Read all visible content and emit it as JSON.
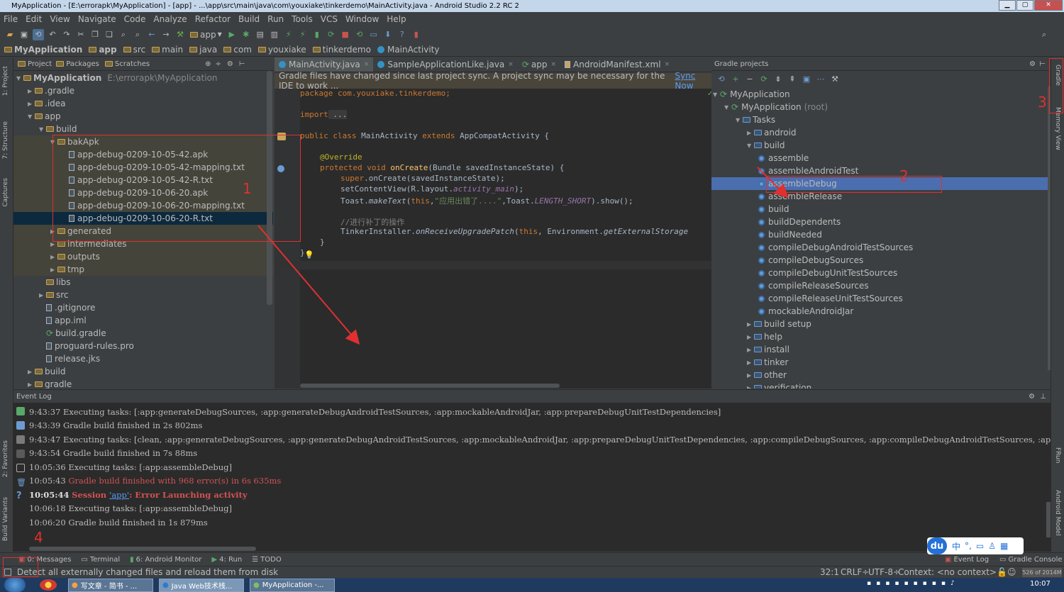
{
  "window": {
    "title": "MyApplication - [E:\\errorapk\\MyApplication] - [app] - ...\\app\\src\\main\\java\\com\\youxiake\\tinkerdemo\\MainActivity.java - Android Studio 2.2 RC 2"
  },
  "menu": [
    "File",
    "Edit",
    "View",
    "Navigate",
    "Code",
    "Analyze",
    "Refactor",
    "Build",
    "Run",
    "Tools",
    "VCS",
    "Window",
    "Help"
  ],
  "toolbar": {
    "run_config": "app"
  },
  "breadcrumb": [
    "MyApplication",
    "app",
    "src",
    "main",
    "java",
    "com",
    "youxiake",
    "tinkerdemo",
    "MainActivity"
  ],
  "project_panel": {
    "tabs": [
      "Project",
      "Packages",
      "Scratches"
    ],
    "tree": [
      {
        "label": "MyApplication",
        "extra": "E:\\errorapk\\MyApplication",
        "level": 0,
        "type": "module",
        "open": true
      },
      {
        "label": ".gradle",
        "level": 1,
        "type": "folder",
        "open": false
      },
      {
        "label": ".idea",
        "level": 1,
        "type": "folder",
        "open": false
      },
      {
        "label": "app",
        "level": 1,
        "type": "folder",
        "open": true
      },
      {
        "label": "build",
        "level": 2,
        "type": "folder",
        "open": true
      },
      {
        "label": "bakApk",
        "level": 3,
        "type": "folder",
        "open": true
      },
      {
        "label": "app-debug-0209-10-05-42.apk",
        "level": 4,
        "type": "file"
      },
      {
        "label": "app-debug-0209-10-05-42-mapping.txt",
        "level": 4,
        "type": "file"
      },
      {
        "label": "app-debug-0209-10-05-42-R.txt",
        "level": 4,
        "type": "file"
      },
      {
        "label": "app-debug-0209-10-06-20.apk",
        "level": 4,
        "type": "file"
      },
      {
        "label": "app-debug-0209-10-06-20-mapping.txt",
        "level": 4,
        "type": "file"
      },
      {
        "label": "app-debug-0209-10-06-20-R.txt",
        "level": 4,
        "type": "file",
        "selected": true
      },
      {
        "label": "generated",
        "level": 3,
        "type": "folder",
        "open": false
      },
      {
        "label": "intermediates",
        "level": 3,
        "type": "folder",
        "open": false
      },
      {
        "label": "outputs",
        "level": 3,
        "type": "folder",
        "open": false
      },
      {
        "label": "tmp",
        "level": 3,
        "type": "folder",
        "open": false
      },
      {
        "label": "libs",
        "level": 2,
        "type": "folder"
      },
      {
        "label": "src",
        "level": 2,
        "type": "folder",
        "open": false
      },
      {
        "label": ".gitignore",
        "level": 2,
        "type": "file"
      },
      {
        "label": "app.iml",
        "level": 2,
        "type": "file"
      },
      {
        "label": "build.gradle",
        "level": 2,
        "type": "gradle"
      },
      {
        "label": "proguard-rules.pro",
        "level": 2,
        "type": "file"
      },
      {
        "label": "release.jks",
        "level": 2,
        "type": "file"
      },
      {
        "label": "build",
        "level": 1,
        "type": "folder",
        "open": false
      },
      {
        "label": "gradle",
        "level": 1,
        "type": "folder",
        "open": false
      }
    ]
  },
  "editor": {
    "tabs": [
      {
        "label": "MainActivity.java",
        "active": true
      },
      {
        "label": "SampleApplicationLike.java",
        "active": false
      },
      {
        "label": "app",
        "active": false
      },
      {
        "label": "AndroidManifest.xml",
        "active": false
      }
    ],
    "notice": "Gradle files have changed since last project sync. A project sync may be necessary for the IDE to work ...",
    "notice_link": "Sync Now",
    "code": {
      "l1": "package com.youxiake.tinkerdemo;",
      "l2_kw": "import",
      "l2_rest": " ...",
      "l3_a": "public class ",
      "l3_b": "MainActivity ",
      "l3_c": "extends ",
      "l3_d": "AppCompatActivity {",
      "l4": "@Override",
      "l5_a": "protected void ",
      "l5_b": "onCreate",
      "l5_c": "(Bundle savedInstanceState) {",
      "l6_a": "super",
      "l6_b": ".onCreate(savedInstanceState);",
      "l7_a": "setContentView(R.layout.",
      "l7_b": "activity_main",
      "l7_c": ");",
      "l8_a": "Toast.",
      "l8_b": "makeText",
      "l8_c": "(",
      "l8_d": "this",
      "l8_e": ",",
      "l8_f": "\"应用出错了....\"",
      "l8_g": ",Toast.",
      "l8_h": "LENGTH_SHORT",
      "l8_i": ").show();",
      "l9": "//进行补丁的操作",
      "l10_a": "TinkerInstaller.",
      "l10_b": "onReceiveUpgradePatch",
      "l10_c": "(",
      "l10_d": "this",
      "l10_e": ", Environment.",
      "l10_f": "getExternalStorage",
      "l11": "}",
      "l12": "}"
    }
  },
  "gradle_panel": {
    "title": "Gradle projects",
    "tree": [
      {
        "label": "MyApplication",
        "level": 0,
        "type": "root"
      },
      {
        "label": "MyApplication",
        "extra": "(root)",
        "level": 1,
        "type": "root"
      },
      {
        "label": "Tasks",
        "level": 2,
        "type": "folder"
      },
      {
        "label": "android",
        "level": 3,
        "type": "folder",
        "collapsed": true
      },
      {
        "label": "build",
        "level": 3,
        "type": "folder"
      },
      {
        "label": "assemble",
        "level": 4,
        "type": "task"
      },
      {
        "label": "assembleAndroidTest",
        "level": 4,
        "type": "task"
      },
      {
        "label": "assembleDebug",
        "level": 4,
        "type": "task",
        "selected": true
      },
      {
        "label": "assembleRelease",
        "level": 4,
        "type": "task"
      },
      {
        "label": "build",
        "level": 4,
        "type": "task"
      },
      {
        "label": "buildDependents",
        "level": 4,
        "type": "task"
      },
      {
        "label": "buildNeeded",
        "level": 4,
        "type": "task"
      },
      {
        "label": "compileDebugAndroidTestSources",
        "level": 4,
        "type": "task"
      },
      {
        "label": "compileDebugSources",
        "level": 4,
        "type": "task"
      },
      {
        "label": "compileDebugUnitTestSources",
        "level": 4,
        "type": "task"
      },
      {
        "label": "compileReleaseSources",
        "level": 4,
        "type": "task"
      },
      {
        "label": "compileReleaseUnitTestSources",
        "level": 4,
        "type": "task"
      },
      {
        "label": "mockableAndroidJar",
        "level": 4,
        "type": "task"
      },
      {
        "label": "build setup",
        "level": 3,
        "type": "folder",
        "collapsed": true
      },
      {
        "label": "help",
        "level": 3,
        "type": "folder",
        "collapsed": true
      },
      {
        "label": "install",
        "level": 3,
        "type": "folder",
        "collapsed": true
      },
      {
        "label": "tinker",
        "level": 3,
        "type": "folder",
        "collapsed": true
      },
      {
        "label": "other",
        "level": 3,
        "type": "folder",
        "collapsed": true
      },
      {
        "label": "verification",
        "level": 3,
        "type": "folder",
        "collapsed": true
      }
    ]
  },
  "event_log": {
    "title": "Event Log",
    "lines": [
      {
        "time": "9:43:37",
        "text": "Executing tasks: [:app:generateDebugSources, :app:generateDebugAndroidTestSources, :app:mockableAndroidJar, :app:prepareDebugUnitTestDependencies]"
      },
      {
        "time": "9:43:39",
        "text": "Gradle build finished in 2s 802ms"
      },
      {
        "time": "9:43:47",
        "text": "Executing tasks: [clean, :app:generateDebugSources, :app:generateDebugAndroidTestSources, :app:mockableAndroidJar, :app:prepareDebugUnitTestDependencies, :app:compileDebugSources, :app:compileDebugAndroidTestSources, :ap"
      },
      {
        "time": "9:43:54",
        "text": "Gradle build finished in 7s 88ms"
      },
      {
        "time": "10:05:36",
        "text": "Executing tasks: [:app:assembleDebug]"
      },
      {
        "time": "10:05:43",
        "text": "Gradle build finished with 968 error(s) in 6s 635ms",
        "error": true
      },
      {
        "time": "10:05:44",
        "text_a": "Session ",
        "link": "'app'",
        "text_b": ": Error Launching activity",
        "bold": true
      },
      {
        "time": "10:06:18",
        "text": "Executing tasks: [:app:assembleDebug]"
      },
      {
        "time": "10:06:20",
        "text": "Gradle build finished in 1s 879ms"
      }
    ]
  },
  "left_tools": [
    "1: Project",
    "7: Structure",
    "Captures",
    "2: Favorites",
    "Build Variants"
  ],
  "right_tools": [
    "Gradle",
    "Memory View",
    "FRun",
    "Android Model"
  ],
  "bottom_tools": [
    "0: Messages",
    "Terminal",
    "6: Android Monitor",
    "4: Run",
    "TODO"
  ],
  "bottom_right_tools": [
    "Event Log",
    "Gradle Console"
  ],
  "status": {
    "message": "Detect all externally changed files and reload them from disk",
    "position": "32:1",
    "line_sep": "CRLF÷",
    "encoding": "UTF-8÷",
    "context": "Context: <no context>",
    "memory": "526 of 2014M"
  },
  "ime": {
    "brand": "du",
    "lang": "中"
  },
  "taskbar": {
    "items": [
      "写文章 - 简书 - ...",
      "Java Web技术栈...",
      "MyApplication -..."
    ],
    "clock": "10:07"
  },
  "annotations": [
    "1",
    "2",
    "3",
    "4"
  ]
}
